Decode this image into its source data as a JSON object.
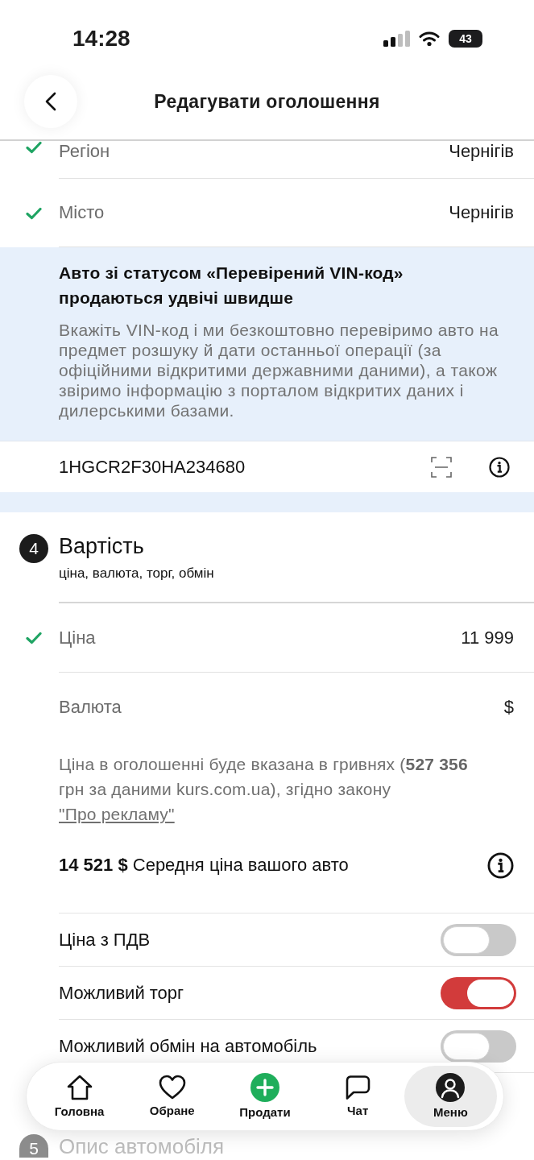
{
  "status_bar": {
    "time": "14:28",
    "battery": "43"
  },
  "header": {
    "title": "Редагувати оголошення"
  },
  "location_rows": [
    {
      "label": "Регіон",
      "value": "Чернігів",
      "done": true
    },
    {
      "label": "Місто",
      "value": "Чернігів",
      "done": true
    }
  ],
  "vin_promo": {
    "title": "Авто зі статусом «Перевірений VIN-код» продаються удвічі швидше",
    "text": "Вкажіть VIN-код і ми безкоштовно перевіримо авто на предмет розшуку й дати останньої операції (за офіційними відкритими державними даними), а також звіримо інформацію з порталом відкритих даних і дилерськими базами."
  },
  "vin_field": {
    "value": "1HGCR2F30HA234680"
  },
  "price_section": {
    "number": "4",
    "title": "Вартість",
    "subtitle": "ціна, валюта, торг, обмін",
    "rows": [
      {
        "label": "Ціна",
        "value": "11 999",
        "done": true
      },
      {
        "label": "Валюта",
        "value": "$",
        "done": false
      }
    ],
    "note": "Ціна в оголошенні буде вказана в гривнях (**527 356** грн за даними kurs.com.ua), згідно закону",
    "note_link": "\"Про рекламу\"",
    "average": "**14 521 $** Середня ціна вашого авто",
    "toggles": [
      {
        "label": "Ціна з ПДВ",
        "on": false
      },
      {
        "label": "Можливий торг",
        "on": true
      },
      {
        "label": "Можливий обмін на автомобіль",
        "on": false
      }
    ]
  },
  "next_section": {
    "number": "5",
    "title": "Опис автомобіля"
  },
  "tab_bar": [
    {
      "kind": "home",
      "label": "Головна",
      "selected": false
    },
    {
      "kind": "heart",
      "label": "Обране",
      "selected": false
    },
    {
      "kind": "plus",
      "label": "Продати",
      "selected": false
    },
    {
      "kind": "chat",
      "label": "Чат",
      "selected": false
    },
    {
      "kind": "profile",
      "label": "Меню",
      "selected": true
    }
  ]
}
